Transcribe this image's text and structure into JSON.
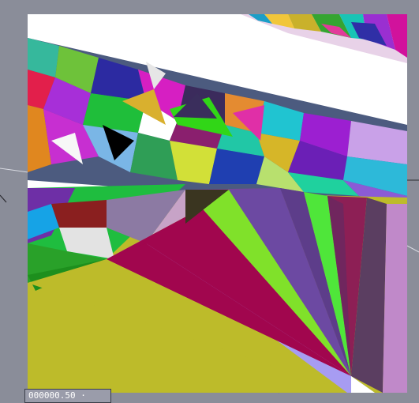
{
  "status": {
    "frame_readout": "000000.50 ·"
  },
  "colors": {
    "background": "#8a8d99",
    "canvas": "#ffffff",
    "floor_yellow": "#bdbb2a",
    "lavender": "#a79cf2",
    "crimson": "#a1064e",
    "purple": "#7c4896",
    "violet": "#6c49a2",
    "lime": "#80e12a",
    "green": "#4fe63a",
    "dark_mauve": "#5b3e61",
    "pink_mauve": "#c089c9",
    "rose": "#8d1f55"
  },
  "viewport": {
    "content": "triangle-mesh-render"
  }
}
